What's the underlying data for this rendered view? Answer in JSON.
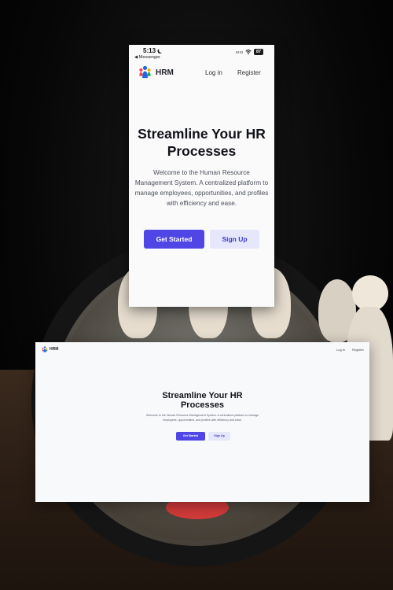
{
  "mobile": {
    "status_bar": {
      "time": "5:13",
      "back_label": "◀ Messenger",
      "battery": "87",
      "icons": [
        "moon-icon",
        "signal-icon",
        "wifi-icon"
      ]
    },
    "nav": {
      "brand": "HRM",
      "login": "Log in",
      "register": "Register"
    },
    "hero": {
      "title": "Streamline Your HR Processes",
      "description": "Welcome to the Human Resource Management System. A centralized platform to manage employees, opportunities, and profiles with efficiency and ease.",
      "primary_button": "Get Started",
      "secondary_button": "Sign Up"
    }
  },
  "desktop": {
    "nav": {
      "brand": "HRM",
      "login": "Log in",
      "register": "Register"
    },
    "hero": {
      "title": "Streamline Your HR Processes",
      "description": "Welcome to the Human Resource Management System. A centralized platform to manage employees, opportunities, and profiles with efficiency and ease.",
      "primary_button": "Get Started",
      "secondary_button": "Sign Up"
    }
  },
  "colors": {
    "primary": "#4f46e5",
    "secondary_bg": "#e6e7fb",
    "secondary_text": "#3f39c5",
    "page_bg": "#f8f9fb",
    "logo_blue": "#2563eb",
    "logo_red": "#ef4444",
    "logo_yellow": "#f5b301",
    "logo_green": "#22a55a"
  }
}
